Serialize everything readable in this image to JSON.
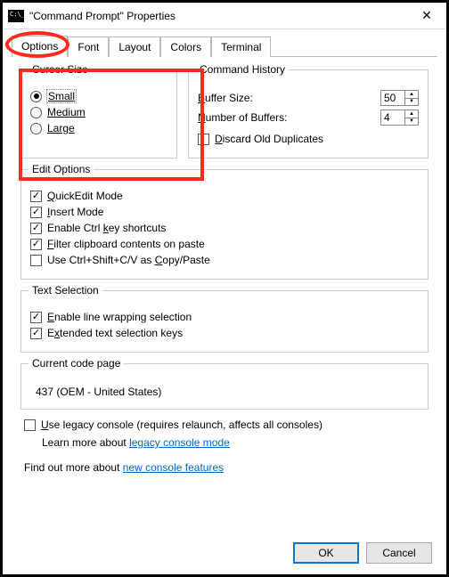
{
  "window": {
    "title": "\"Command Prompt\" Properties",
    "close_glyph": "✕"
  },
  "tabs": {
    "options": "Options",
    "font": "Font",
    "layout": "Layout",
    "colors": "Colors",
    "terminal": "Terminal"
  },
  "cursor": {
    "title": "Cursor Size",
    "small": "Small",
    "medium": "Medium",
    "large": "Large"
  },
  "history": {
    "title": "Command History",
    "buffer_label_pre": "B",
    "buffer_label_rest": "uffer Size:",
    "buffer_value": "50",
    "num_label_pre": "N",
    "num_label_rest": "umber of Buffers:",
    "num_value": "4",
    "discard_pre": "D",
    "discard_rest": "iscard Old Duplicates"
  },
  "edit": {
    "title": "Edit Options",
    "quickedit_pre": "Q",
    "quickedit_rest": "uickEdit Mode",
    "insert_pre": "I",
    "insert_rest": "nsert Mode",
    "ctrl_pre_txt": "Enable Ctrl ",
    "ctrl_u": "k",
    "ctrl_post": "ey shortcuts",
    "filter_pre": "F",
    "filter_rest": "ilter clipboard contents on paste",
    "usecv_pre": "Use Ctrl+Shift+C/V as ",
    "usecv_u": "C",
    "usecv_post": "opy/Paste"
  },
  "sel": {
    "title": "Text Selection",
    "wrap_pre": "E",
    "wrap_rest": "nable line wrapping selection",
    "ext_pre": "E",
    "ext_u": "x",
    "ext_rest": "tended text selection keys"
  },
  "codepage": {
    "title": "Current code page",
    "value": "437   (OEM - United States)"
  },
  "legacy": {
    "check_pre": "U",
    "check_rest": "se legacy console (requires relaunch, affects all consoles)",
    "learn_pre": "Learn more about ",
    "learn_link": "legacy console mode"
  },
  "findmore": {
    "pre": "Find out more about ",
    "link": "new console features"
  },
  "buttons": {
    "ok": "OK",
    "cancel": "Cancel"
  }
}
